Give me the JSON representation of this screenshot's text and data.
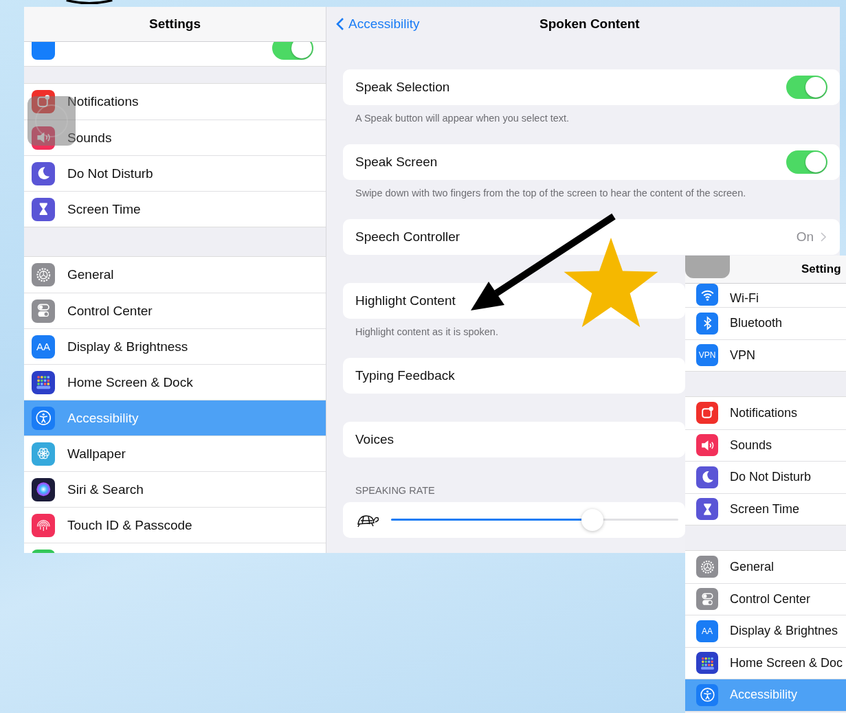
{
  "sidebar": {
    "title": "Settings",
    "groups": [
      {
        "items": [
          {
            "kind": "partial",
            "color": "#157efb",
            "on": true,
            "selected": false
          }
        ]
      },
      {
        "items": [
          {
            "kind": "notifications",
            "label": "Notifications",
            "selected": false
          },
          {
            "kind": "sounds",
            "label": "Sounds",
            "color": "#f2305a",
            "selected": false
          },
          {
            "kind": "moon",
            "label": "Do Not Disturb",
            "color": "#5a55d6",
            "selected": false
          },
          {
            "kind": "hourglass",
            "label": "Screen Time",
            "color": "#5a55d6",
            "selected": false
          }
        ]
      },
      {
        "items": [
          {
            "kind": "gear",
            "label": "General",
            "color": "#8e8e93",
            "selected": false
          },
          {
            "kind": "switches",
            "label": "Control Center",
            "color": "#8e8e93",
            "selected": false
          },
          {
            "kind": "text",
            "label": "Display & Brightness",
            "icon_text": "AA",
            "color": "#1a7cf5",
            "selected": false
          },
          {
            "kind": "grid",
            "label": "Home Screen & Dock",
            "color": "#2c3fc8",
            "selected": false
          },
          {
            "kind": "accessibility",
            "label": "Accessibility",
            "color": "#1a7cf5",
            "selected": true
          },
          {
            "kind": "flower",
            "label": "Wallpaper",
            "color": "#35a9dc",
            "selected": false
          },
          {
            "kind": "siri",
            "label": "Siri & Search",
            "color": "#1c1c3a",
            "selected": false
          },
          {
            "kind": "fingerprint",
            "label": "Touch ID & Passcode",
            "color": "#f2305a",
            "selected": false
          },
          {
            "kind": "partial",
            "color": "#34c759",
            "selected": false
          }
        ]
      }
    ]
  },
  "detail": {
    "back": "Accessibility",
    "title": "Spoken Content",
    "sections": [
      {
        "rows": [
          {
            "kind": "toggle",
            "label": "Speak Selection",
            "on": true
          }
        ],
        "footer": "A Speak button will appear when you select text."
      },
      {
        "rows": [
          {
            "kind": "toggle",
            "label": "Speak Screen",
            "on": true
          }
        ],
        "footer": "Swipe down with two fingers from the top of the screen to hear the content of the screen."
      },
      {
        "rows": [
          {
            "kind": "link",
            "label": "Speech Controller",
            "value": "On"
          }
        ]
      },
      {
        "rows": [
          {
            "kind": "link",
            "label": "Highlight Content"
          }
        ],
        "footer": "Highlight content as it is spoken."
      },
      {
        "rows": [
          {
            "kind": "link",
            "label": "Typing Feedback"
          }
        ]
      },
      {
        "rows": [
          {
            "kind": "link",
            "label": "Voices"
          }
        ]
      },
      {
        "header": "SPEAKING RATE",
        "rows": [
          {
            "kind": "slider",
            "level": 0.7
          }
        ]
      }
    ]
  },
  "overlay": {
    "title": "Setting",
    "groups": [
      {
        "items": [
          {
            "kind": "wifi",
            "label": "Wi-Fi",
            "color": "#1a7cf5",
            "selected": false
          },
          {
            "kind": "bluetooth",
            "label": "Bluetooth",
            "color": "#1a7cf5",
            "selected": false
          },
          {
            "kind": "vpn",
            "label": "VPN",
            "icon_text": "VPN",
            "color": "#1a7cf5",
            "selected": false
          }
        ]
      },
      {
        "items": [
          {
            "kind": "notifications",
            "label": "Notifications",
            "color": "#f0302a",
            "selected": false
          },
          {
            "kind": "sounds",
            "label": "Sounds",
            "color": "#f2305a",
            "selected": false
          },
          {
            "kind": "moon",
            "label": "Do Not Disturb",
            "color": "#5a55d6",
            "selected": false
          },
          {
            "kind": "hourglass",
            "label": "Screen Time",
            "color": "#5a55d6",
            "selected": false
          }
        ]
      },
      {
        "items": [
          {
            "kind": "gear",
            "label": "General",
            "color": "#8e8e93",
            "selected": false
          },
          {
            "kind": "switches",
            "label": "Control Center",
            "color": "#8e8e93",
            "selected": false
          },
          {
            "kind": "text",
            "label": "Display & Brightnes",
            "icon_text": "AA",
            "color": "#1a7cf5",
            "selected": false
          },
          {
            "kind": "grid",
            "label": "Home Screen & Doc",
            "color": "#2c3fc8",
            "selected": false
          },
          {
            "kind": "accessibility",
            "label": "Accessibility",
            "color": "#1a7cf5",
            "selected": true
          }
        ]
      }
    ]
  }
}
